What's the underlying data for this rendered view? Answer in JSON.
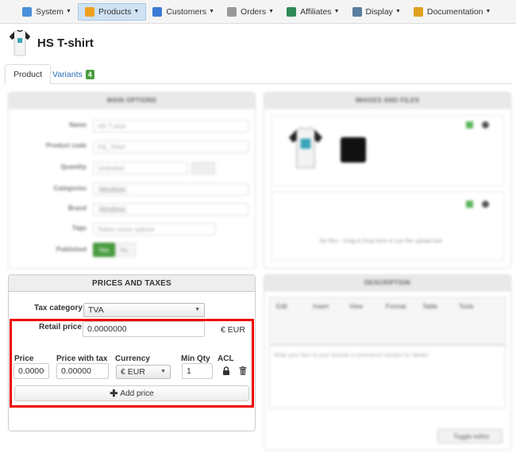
{
  "nav": {
    "items": [
      {
        "label": "System",
        "icon": "tools-icon",
        "color": "#4a90d9",
        "active": false
      },
      {
        "label": "Products",
        "icon": "box-icon",
        "color": "#f0a020",
        "active": true
      },
      {
        "label": "Customers",
        "icon": "users-icon",
        "color": "#3a7bd5",
        "active": false
      },
      {
        "label": "Orders",
        "icon": "cart-icon",
        "color": "#999999",
        "active": false
      },
      {
        "label": "Affiliates",
        "icon": "affiliate-icon",
        "color": "#2e8b57",
        "active": false
      },
      {
        "label": "Display",
        "icon": "display-icon",
        "color": "#5a7fa0",
        "active": false
      },
      {
        "label": "Documentation",
        "icon": "book-icon",
        "color": "#e0a020",
        "active": false
      }
    ]
  },
  "header": {
    "title": "HS T-shirt"
  },
  "tabs": {
    "product": "Product",
    "variants": "Variants",
    "variants_count": "4"
  },
  "main_options": {
    "heading": "MAIN OPTIONS",
    "labels": [
      "Name",
      "Product code",
      "Quantity",
      "Categories",
      "Brand",
      "Tags",
      "Published"
    ],
    "name_value": "HS T-shirt",
    "code_value": "HS_Tshirt",
    "quantity_value": "Unlimited",
    "categories_value": "Mindfree",
    "brand_value": "Mindfree",
    "tags_placeholder": "Select some options",
    "published_yes": "Yes",
    "published_no": "No"
  },
  "images": {
    "heading": "IMAGES AND FILES",
    "files_hint": "No files - Drag & Drop here or use the upload tool"
  },
  "prices": {
    "heading": "PRICES AND TAXES",
    "tax_category_label": "Tax category",
    "tax_category_value": "TVA",
    "retail_price_label": "Retail price",
    "retail_price_value": "0.0000000",
    "retail_currency": "€ EUR",
    "columns": {
      "price": "Price",
      "price_with_tax": "Price with tax",
      "currency": "Currency",
      "min_qty": "Min Qty",
      "acl": "ACL"
    },
    "row": {
      "price": "0.00000",
      "price_with_tax": "0.00000",
      "currency": "€ EUR",
      "min_qty": "1"
    },
    "add_price_label": "Add price"
  },
  "description": {
    "heading": "DESCRIPTION",
    "menus": [
      "Edit",
      "Insert",
      "View",
      "Format",
      "Table",
      "Tools"
    ],
    "placeholder": "Write your item to your favorite e-commerce solution for ideals!",
    "toggle_label": "Toggle editor"
  }
}
